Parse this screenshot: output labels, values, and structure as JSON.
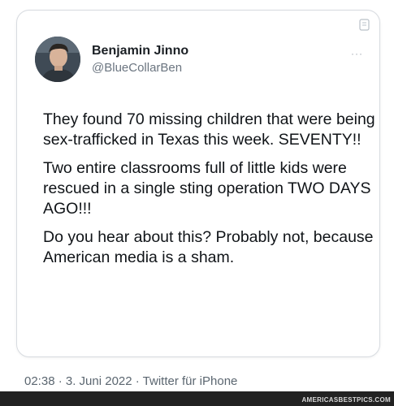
{
  "tweet": {
    "author": {
      "display_name": "Benjamin Jinno",
      "handle": "@BlueCollarBen"
    },
    "paragraphs": [
      "They found 70 missing children that were being sex-trafficked in Texas this week. SEVENTY!!",
      "Two entire classrooms full of little kids were rescued in a single sting operation TWO DAYS AGO!!!",
      "Do you hear about this? Probably not, because American media is a sham."
    ],
    "more_glyph": "···"
  },
  "meta": {
    "timestamp": "02:38 · 3. Juni 2022 · Twitter für iPhone"
  },
  "watermark": "AMERICASBESTPICS.COM",
  "icons": {
    "avatar": "profile-photo",
    "expand": "expand-icon",
    "more": "more-options-icon"
  },
  "colors": {
    "text": "#0f1419",
    "secondary": "#5b6670",
    "border": "#d7dbe0"
  }
}
